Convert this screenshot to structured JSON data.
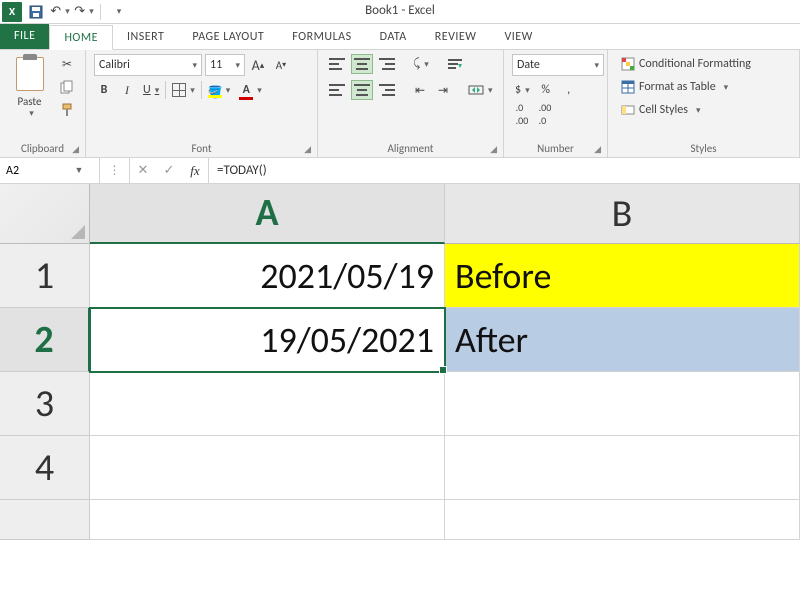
{
  "window": {
    "title": "Book1 - Excel"
  },
  "tabs": {
    "file": "FILE",
    "items": [
      "HOME",
      "INSERT",
      "PAGE LAYOUT",
      "FORMULAS",
      "DATA",
      "REVIEW",
      "VIEW"
    ],
    "active": "HOME"
  },
  "ribbon": {
    "clipboard": {
      "paste": "Paste",
      "group": "Clipboard"
    },
    "font": {
      "group": "Font",
      "name": "Calibri",
      "size": "11",
      "bold": "B",
      "italic": "I",
      "underline": "U",
      "inc": "A",
      "dec": "A",
      "color_letter": "A"
    },
    "alignment": {
      "group": "Alignment"
    },
    "number": {
      "group": "Number",
      "format": "Date",
      "currency_ic": "$",
      "percent": "%",
      "comma": ","
    },
    "styles": {
      "group": "Styles",
      "cond": "Conditional Formatting",
      "table": "Format as Table",
      "cellstyles": "Cell Styles"
    }
  },
  "formula_bar": {
    "name_box": "A2",
    "formula": "=TODAY()"
  },
  "grid": {
    "columns": [
      "A",
      "B"
    ],
    "rows": [
      "1",
      "2",
      "3",
      "4"
    ],
    "active_cell": "A2",
    "cells": {
      "A1": "2021/05/19",
      "B1": "Before",
      "A2": "19/05/2021",
      "B2": "After"
    }
  }
}
